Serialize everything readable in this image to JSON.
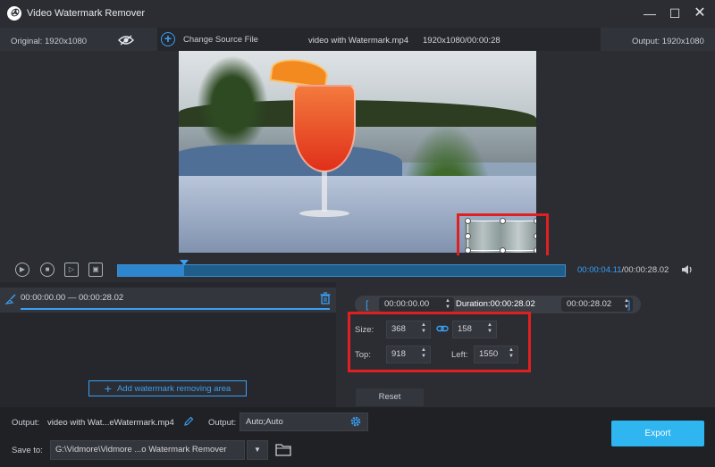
{
  "app": {
    "title": "Video Watermark Remover"
  },
  "window_controls": {
    "minimize": "—",
    "maximize": "☐",
    "close": "✕"
  },
  "info": {
    "original": "Original: 1920x1080",
    "change_source": "Change Source File",
    "file_name": "video with Watermark.mp4",
    "file_meta": "1920x1080/00:00:28",
    "output": "Output: 1920x1080"
  },
  "playback": {
    "time_current": "00:00:04.11",
    "time_total": "/00:00:28.02",
    "progress_fraction": 0.147
  },
  "clip": {
    "range": "00:00:00.00 — 00:00:28.02",
    "add_area_label": "Add watermark removing area"
  },
  "settings": {
    "start_time": "00:00:00.00",
    "duration_label": "Duration:00:00:28.02",
    "end_time": "00:00:28.02",
    "size_label": "Size:",
    "size_width": "368",
    "size_height": "158",
    "top_label": "Top:",
    "top_value": "918",
    "left_label": "Left:",
    "left_value": "1550",
    "reset_label": "Reset"
  },
  "footer": {
    "output_label": "Output:",
    "output_file": "video with Wat...eWatermark.mp4",
    "output_label2": "Output:",
    "output_format": "Auto;Auto",
    "saveto_label": "Save to:",
    "saveto_path": "G:\\Vidmore\\Vidmore ...o Watermark Remover",
    "export_label": "Export"
  },
  "colors": {
    "accent": "#3aa0f5",
    "export": "#2fb5f0",
    "highlight": "#e02020",
    "background": "#2b2d33"
  },
  "icons": [
    "app-logo-icon",
    "eye-icon",
    "plus-circle-icon",
    "play-icon",
    "stop-icon",
    "frame-icon",
    "clip-icon",
    "volume-icon",
    "brush-icon",
    "trash-icon",
    "link-icon",
    "pencil-icon",
    "gear-icon",
    "folder-icon",
    "chevron-down-icon"
  ]
}
